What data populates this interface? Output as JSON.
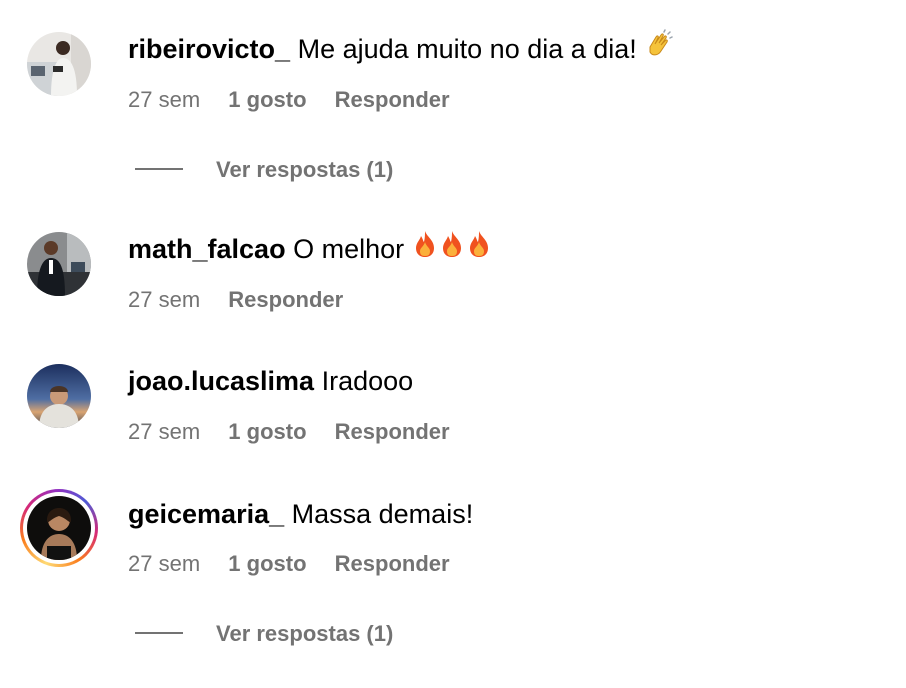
{
  "comments": [
    {
      "username": "ribeirovicto_",
      "text": "Me ajuda muito no dia a dia!",
      "emoji": "clapping-hands",
      "time": "27 sem",
      "likes": "1 gosto",
      "reply_label": "Responder",
      "view_replies": "Ver respostas (1)"
    },
    {
      "username": "math_falcao",
      "text": "O melhor",
      "emoji": "fire x3",
      "time": "27 sem",
      "reply_label": "Responder"
    },
    {
      "username": "joao.lucaslima",
      "text": "Iradooo",
      "time": "27 sem",
      "likes": "1 gosto",
      "reply_label": "Responder"
    },
    {
      "username": "geicemaria_",
      "text": "Massa demais!",
      "time": "27 sem",
      "likes": "1 gosto",
      "reply_label": "Responder",
      "view_replies": "Ver respostas (1)",
      "has_story_ring": true
    }
  ],
  "colors": {
    "secondary_text": "#737373",
    "primary_text": "#000000"
  }
}
